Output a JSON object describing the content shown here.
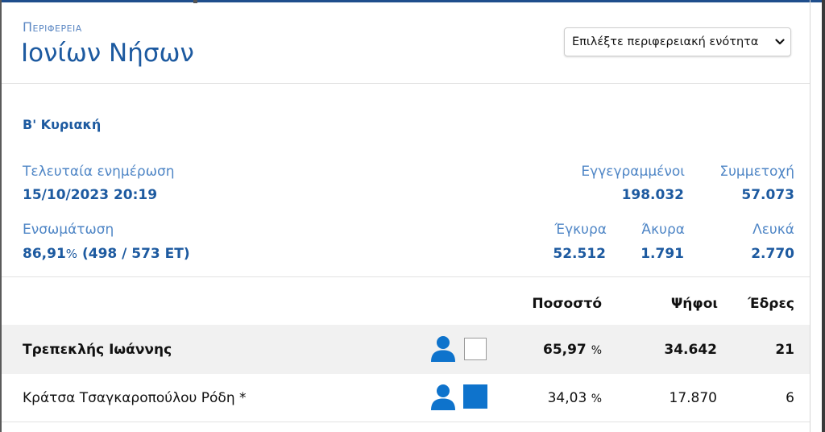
{
  "header": {
    "supertitle": "Περιφερεια",
    "title": "Ιονίων Νήσων"
  },
  "selector": {
    "value": "Επιλέξτε περιφερειακή ενότητα"
  },
  "round": "Β' Κυριακή",
  "stats": {
    "last_update_label": "Τελευταία ενημέρωση",
    "last_update_value": "15/10/2023 20:19",
    "registered_label": "Εγγεγραμμένοι",
    "registered_value": "198.032",
    "turnout_label": "Συμμετοχή",
    "turnout_value": "57.073",
    "integration_label": "Ενσωμάτωση",
    "integration_pct": "86,91",
    "integration_pct_unit": "%",
    "integration_detail": "(498 / 573 ΕΤ)",
    "valid_label": "Έγκυρα",
    "valid_value": "52.512",
    "invalid_label": "Άκυρα",
    "invalid_value": "1.791",
    "blank_label": "Λευκά",
    "blank_value": "2.770"
  },
  "table": {
    "headers": {
      "percent": "Ποσοστό",
      "votes": "Ψήφοι",
      "seats": "Έδρες"
    },
    "rows": [
      {
        "name": "Τρεπεκλής Ιωάννης",
        "percent": "65,97",
        "percent_unit": "%",
        "votes": "34.642",
        "seats": "21",
        "person_icon": "person-icon",
        "swatch": "empty"
      },
      {
        "name": "Κράτσα Τσαγκαροπούλου Ρόδη *",
        "percent": "34,03",
        "percent_unit": "%",
        "votes": "17.870",
        "seats": "6",
        "person_icon": "person-icon",
        "swatch": "#0e73cc"
      }
    ]
  },
  "colors": {
    "accent": "#1d5aa0",
    "label": "#4f86c6",
    "icon": "#0e73cc",
    "row_highlight": "#f1f1f1"
  }
}
